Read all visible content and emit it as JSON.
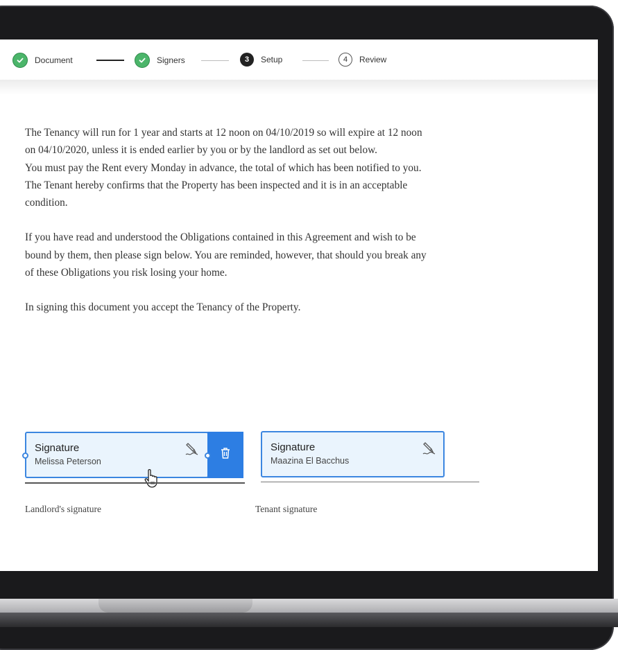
{
  "stepper": {
    "steps": [
      {
        "label": "Document",
        "state": "done"
      },
      {
        "label": "Signers",
        "state": "done"
      },
      {
        "label": "Setup",
        "number": "3",
        "state": "active"
      },
      {
        "label": "Review",
        "number": "4",
        "state": "pending"
      }
    ]
  },
  "document": {
    "paragraph1_lines": [
      "The Tenancy will run for 1 year and starts at 12 noon on 04/10/2019 so will expire at 12 noon on 04/10/2020, unless it is ended earlier by you or by the landlord as set out below.",
      "You must pay the Rent every Monday in advance, the total of which has been notified to you.",
      "The Tenant hereby confirms that the Property has been inspected and it is in an acceptable condition."
    ],
    "paragraph2": "If you have read and understood the Obligations contained in this Agreement and wish to be bound by them, then please sign below. You are reminded, however, that should you break any of these Obligations you risk losing your home.",
    "paragraph3": "In signing this document you accept the Tenancy of the Property."
  },
  "signatures": {
    "landlord": {
      "title": "Signature",
      "name": "Melissa Peterson",
      "caption": "Landlord's signature"
    },
    "tenant": {
      "title": "Signature",
      "name": "Maazina El Bacchus",
      "caption": "Tenant signature"
    }
  },
  "colors": {
    "accent": "#2d7ee3",
    "field_bg": "#eaf4fd",
    "done_green": "#4bb56a"
  },
  "icons": {
    "step_done": "check-icon",
    "signature": "signature-pen-icon",
    "delete": "trash-icon",
    "cursor": "hand-pointer-icon"
  }
}
